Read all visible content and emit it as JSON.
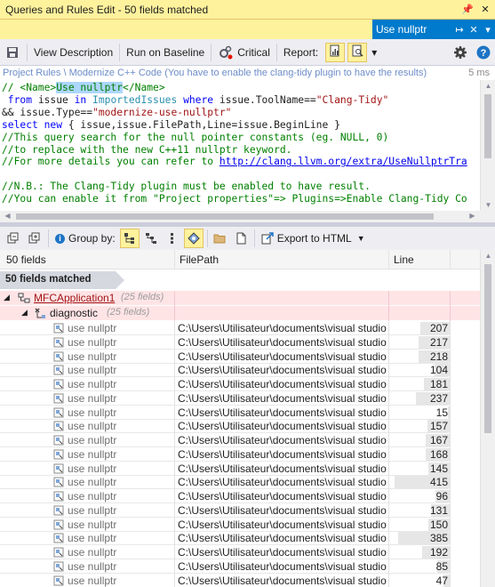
{
  "window": {
    "title": "Queries and Rules Edit",
    "count_label": "- 50 fields matched"
  },
  "tab": {
    "label": "Use nullptr"
  },
  "toolbar": {
    "view_description": "View Description",
    "run_on_baseline": "Run on Baseline",
    "critical": "Critical",
    "report": "Report:"
  },
  "status": {
    "path": "Project Rules \\ Modernize C++ Code (You have to enable the clang-tidy plugin to have the results)",
    "elapsed": "5 ms"
  },
  "code": {
    "l1_a": "// <Name>",
    "l1_b": "Use nullptr",
    "l1_c": "</Name>",
    "l2_from": " from",
    "l2_issue": " issue ",
    "l2_in": "in",
    "l2_sp": " ",
    "l2_imported": "ImportedIssues",
    "l2_sp2": " ",
    "l2_where": "where",
    "l2_rest": " issue.ToolName==",
    "l2_str": "\"Clang-Tidy\"",
    "l3_a": "&& issue.Type==",
    "l3_str": "\"modernize-use-nullptr\"",
    "l4_select": "select",
    "l4_sp": " ",
    "l4_new": "new",
    "l4_rest": " { issue,issue.FilePath,Line=issue.BeginLine }",
    "l5": "//This query search for the null pointer constants (eg. NULL, 0)",
    "l6": "//to replace with the new C++11 nullptr keyword.",
    "l7_a": "//For more details you can refer to ",
    "l7_url": "http://clang.llvm.org/extra/UseNullptrTra",
    "l8": "",
    "l9": "//N.B.: The Clang-Tidy plugin must be enabled to have result.",
    "l10": "//You can enable it from \"Project properties\"=> Plugins=>Enable Clang-Tidy Co"
  },
  "results_toolbar": {
    "group_by": "Group by:",
    "export": "Export to HTML"
  },
  "grid": {
    "col_fields": "50 fields",
    "col_path": "FilePath",
    "col_line": "Line",
    "group_label": "50 fields matched",
    "project": "MFCApplication1",
    "project_count": "(25 fields)",
    "namespace": "diagnostic",
    "namespace_count": "(25 fields)",
    "rows": [
      {
        "name": "use nullptr",
        "path": "C:\\Users\\Utilisateur\\documents\\visual studio 2...",
        "line": "207",
        "bar": 0.54
      },
      {
        "name": "use nullptr",
        "path": "C:\\Users\\Utilisateur\\documents\\visual studio 2...",
        "line": "217",
        "bar": 0.56
      },
      {
        "name": "use nullptr",
        "path": "C:\\Users\\Utilisateur\\documents\\visual studio 2...",
        "line": "218",
        "bar": 0.57
      },
      {
        "name": "use nullptr",
        "path": "C:\\Users\\Utilisateur\\documents\\visual studio 2...",
        "line": "104",
        "bar": 0.27
      },
      {
        "name": "use nullptr",
        "path": "C:\\Users\\Utilisateur\\documents\\visual studio 2...",
        "line": "181",
        "bar": 0.47
      },
      {
        "name": "use nullptr",
        "path": "C:\\Users\\Utilisateur\\documents\\visual studio 2...",
        "line": "237",
        "bar": 0.62
      },
      {
        "name": "use nullptr",
        "path": "C:\\Users\\Utilisateur\\documents\\visual studio 2...",
        "line": "15",
        "bar": 0.04
      },
      {
        "name": "use nullptr",
        "path": "C:\\Users\\Utilisateur\\documents\\visual studio 2...",
        "line": "157",
        "bar": 0.41
      },
      {
        "name": "use nullptr",
        "path": "C:\\Users\\Utilisateur\\documents\\visual studio 2...",
        "line": "167",
        "bar": 0.43
      },
      {
        "name": "use nullptr",
        "path": "C:\\Users\\Utilisateur\\documents\\visual studio 2...",
        "line": "168",
        "bar": 0.44
      },
      {
        "name": "use nullptr",
        "path": "C:\\Users\\Utilisateur\\documents\\visual studio 2...",
        "line": "145",
        "bar": 0.38
      },
      {
        "name": "use nullptr",
        "path": "C:\\Users\\Utilisateur\\documents\\visual studio 2...",
        "line": "415",
        "bar": 1.0
      },
      {
        "name": "use nullptr",
        "path": "C:\\Users\\Utilisateur\\documents\\visual studio 2...",
        "line": "96",
        "bar": 0.25
      },
      {
        "name": "use nullptr",
        "path": "C:\\Users\\Utilisateur\\documents\\visual studio 2...",
        "line": "131",
        "bar": 0.34
      },
      {
        "name": "use nullptr",
        "path": "C:\\Users\\Utilisateur\\documents\\visual studio 2...",
        "line": "150",
        "bar": 0.39
      },
      {
        "name": "use nullptr",
        "path": "C:\\Users\\Utilisateur\\documents\\visual studio 2...",
        "line": "385",
        "bar": 0.93
      },
      {
        "name": "use nullptr",
        "path": "C:\\Users\\Utilisateur\\documents\\visual studio 2...",
        "line": "192",
        "bar": 0.5
      },
      {
        "name": "use nullptr",
        "path": "C:\\Users\\Utilisateur\\documents\\visual studio 2...",
        "line": "85",
        "bar": 0.22
      },
      {
        "name": "use nullptr",
        "path": "C:\\Users\\Utilisateur\\documents\\visual studio 2...",
        "line": "47",
        "bar": 0.12
      }
    ]
  },
  "colors": {
    "accent": "#007acc",
    "title_bg": "#fff29d",
    "toolbar_bg": "#eeeef2",
    "highlight_row": "#ffe4e6",
    "project_link": "#a31515"
  }
}
